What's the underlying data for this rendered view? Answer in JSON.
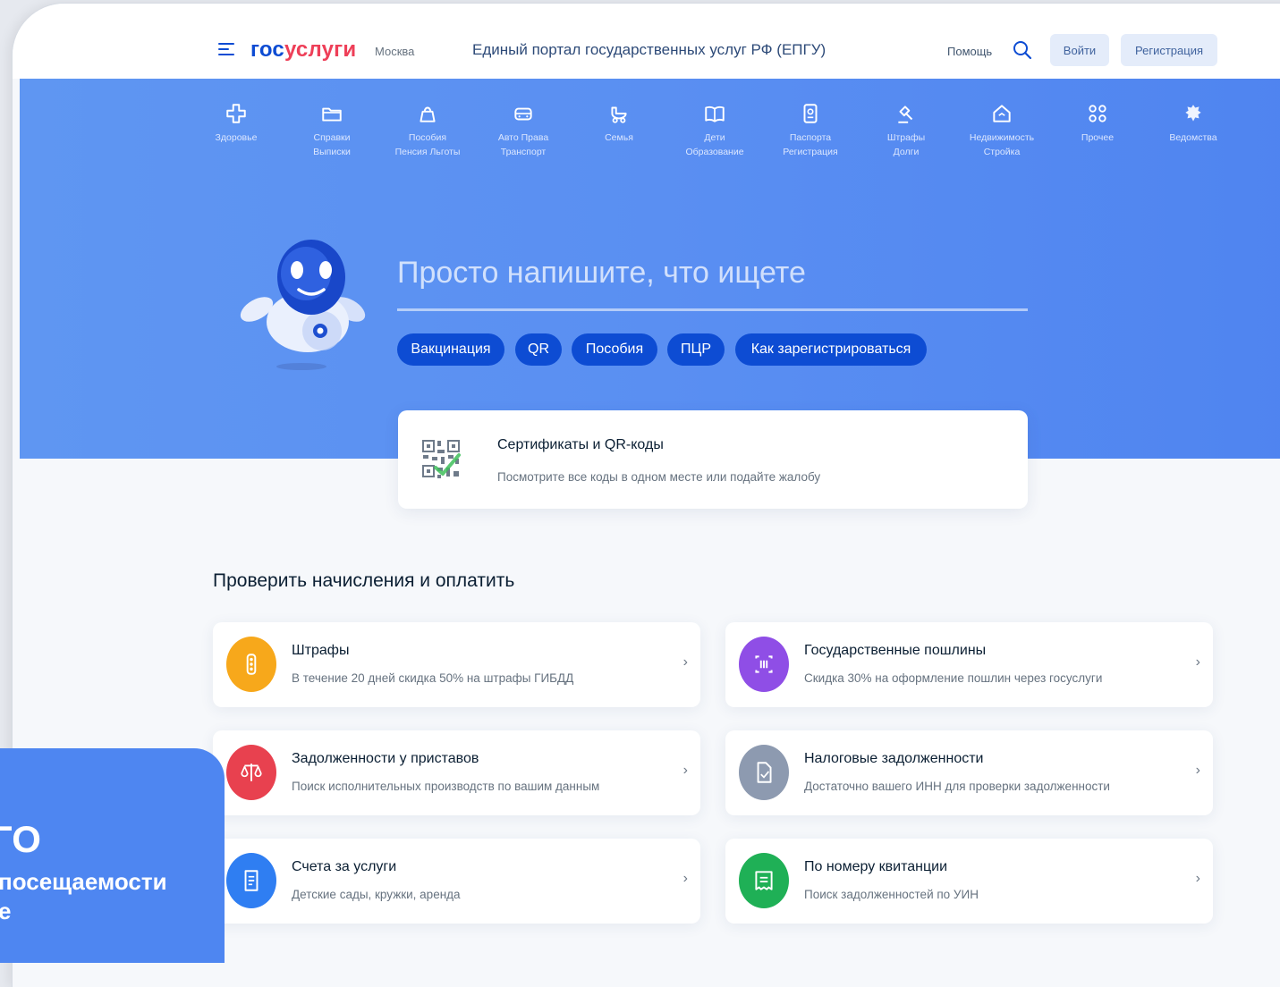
{
  "header": {
    "logo_part1": "гос",
    "logo_part2": "услуги",
    "city": "Москва",
    "portal_title": "Единый портал государственных услуг РФ (ЕПГУ)",
    "help": "Помощь",
    "login": "Войти",
    "register": "Регистрация"
  },
  "categories": [
    {
      "l1": "Здоровье",
      "l2": "",
      "icon": "plus-icon"
    },
    {
      "l1": "Справки",
      "l2": "Выписки",
      "icon": "folder-icon"
    },
    {
      "l1": "Пособия",
      "l2": "Пенсия Льготы",
      "icon": "bag-icon"
    },
    {
      "l1": "Авто Права",
      "l2": "Транспорт",
      "icon": "car-icon"
    },
    {
      "l1": "Семья",
      "l2": "",
      "icon": "stroller-icon"
    },
    {
      "l1": "Дети",
      "l2": "Образование",
      "icon": "book-icon"
    },
    {
      "l1": "Паспорта",
      "l2": "Регистрация",
      "icon": "passport-icon"
    },
    {
      "l1": "Штрафы",
      "l2": "Долги",
      "icon": "gavel-icon"
    },
    {
      "l1": "Недвижимость",
      "l2": "Стройка",
      "icon": "house-icon"
    },
    {
      "l1": "Прочее",
      "l2": "",
      "icon": "grid-icon"
    },
    {
      "l1": "Ведомства",
      "l2": "",
      "icon": "emblem-icon"
    }
  ],
  "search": {
    "placeholder": "Просто напишите, что ищете"
  },
  "chips": [
    "Вакцинация",
    "QR",
    "Пособия",
    "ПЦР",
    "Как зарегистрироваться"
  ],
  "qr_card": {
    "title": "Сертификаты и QR-коды",
    "subtitle": "Посмотрите все коды в одном месте или подайте жалобу"
  },
  "section_title": "Проверить начисления и оплатить",
  "payments": [
    {
      "title": "Штрафы",
      "subtitle": "В течение 20 дней скидка 50% на штрафы ГИБДД",
      "icon": "traffic-light-icon",
      "color": "#f7a81b"
    },
    {
      "title": "Государственные пошлины",
      "subtitle": "Скидка 30% на оформление пошлин через госуслуги",
      "icon": "receipt-icon",
      "color": "#8f4ee6"
    },
    {
      "title": "Задолженности у приставов",
      "subtitle": "Поиск исполнительных производств по вашим данным",
      "icon": "scales-icon",
      "color": "#e8414f"
    },
    {
      "title": "Налоговые задолженности",
      "subtitle": "Достаточно вашего ИНН для проверки задолженности",
      "icon": "document-icon",
      "color": "#8d9ab0"
    },
    {
      "title": "Счета за услуги",
      "subtitle": "Детские сады, кружки, аренда",
      "icon": "bill-icon",
      "color": "#2f7ef2"
    },
    {
      "title": "По номеру квитанции",
      "subtitle": "Поиск задолженностей по УИН",
      "icon": "invoice-icon",
      "color": "#1fb056"
    }
  ],
  "chevron": "›",
  "badge": {
    "big": "ГО",
    "line1": "посещаемости",
    "line2": "е"
  },
  "colors": {
    "brand_blue": "#0d4cd3",
    "brand_red": "#ee3f58",
    "hero": "#5a8ff2"
  }
}
